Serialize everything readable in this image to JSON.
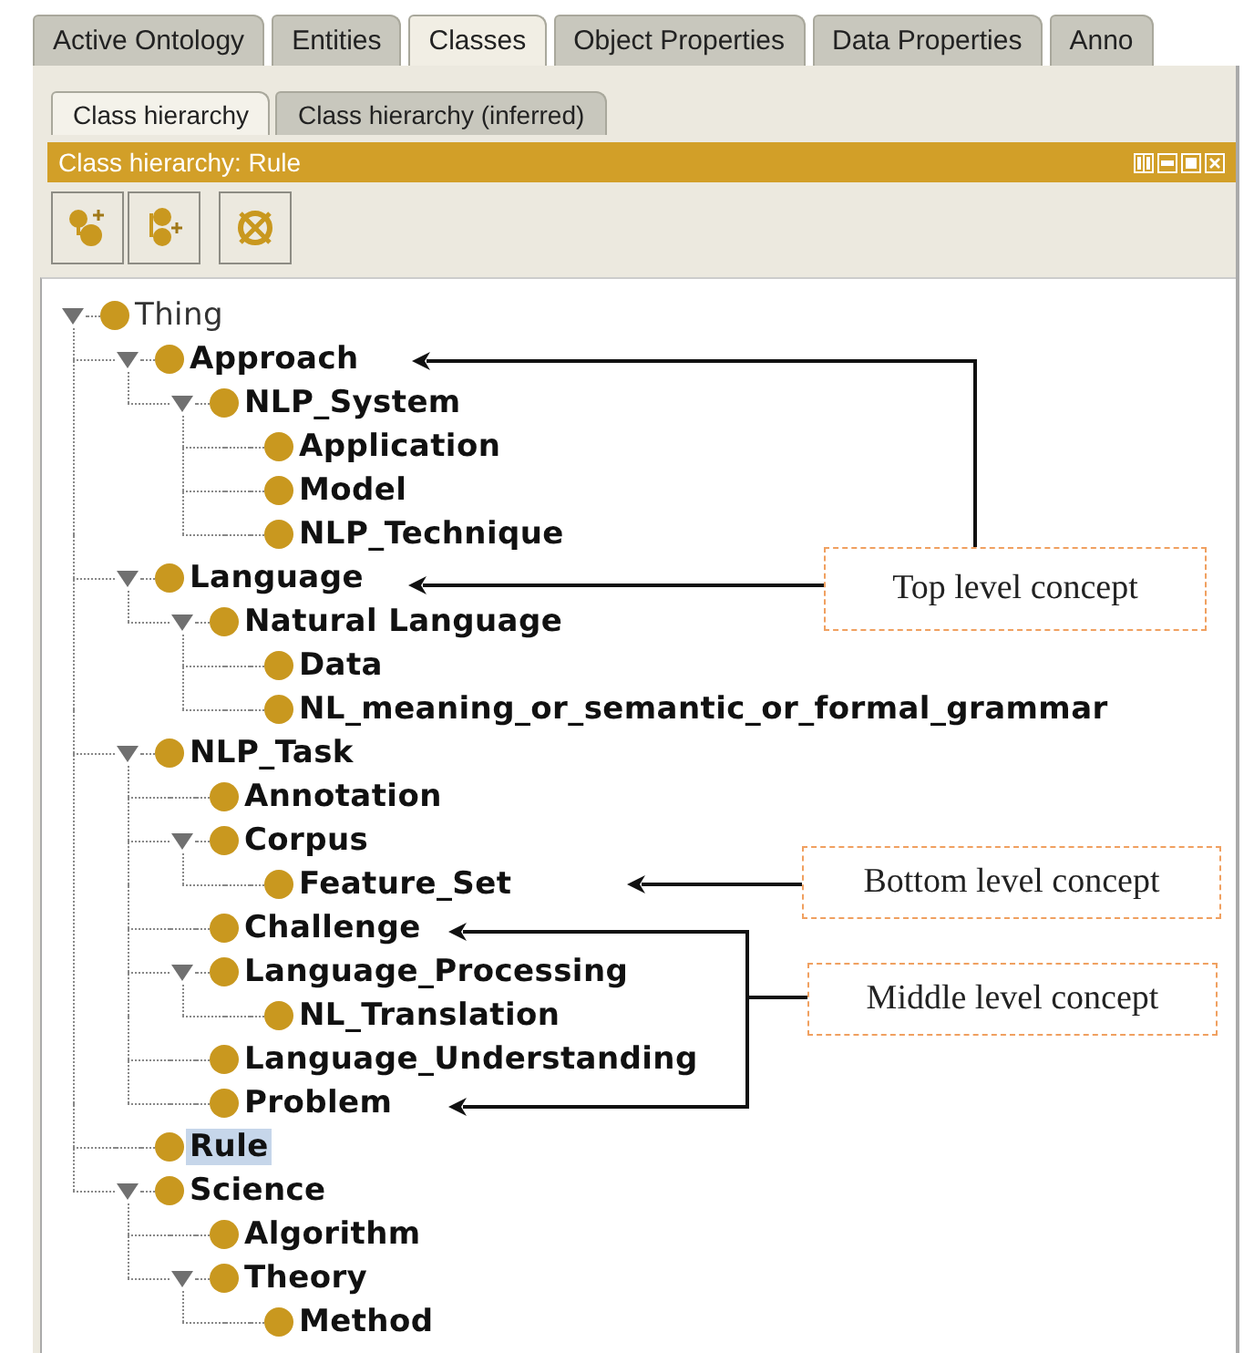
{
  "tabs": [
    {
      "label": "Active Ontology",
      "selected": false
    },
    {
      "label": "Entities",
      "selected": false
    },
    {
      "label": "Classes",
      "selected": true
    },
    {
      "label": "Object Properties",
      "selected": false
    },
    {
      "label": "Data Properties",
      "selected": false
    },
    {
      "label": "Anno",
      "selected": false
    }
  ],
  "subtabs": [
    {
      "label": "Class hierarchy",
      "selected": true
    },
    {
      "label": "Class hierarchy (inferred)",
      "selected": false
    }
  ],
  "panel": {
    "title": "Class hierarchy: Rule"
  },
  "tree": [
    {
      "label": "Thing",
      "kind": "root",
      "selected": false,
      "expanded": true,
      "children": [
        {
          "label": "Approach",
          "selected": false,
          "expanded": true,
          "children": [
            {
              "label": "NLP_System",
              "selected": false,
              "expanded": true,
              "children": [
                {
                  "label": "Application",
                  "selected": false
                },
                {
                  "label": "Model",
                  "selected": false
                },
                {
                  "label": "NLP_Technique",
                  "selected": false
                }
              ]
            }
          ]
        },
        {
          "label": "Language",
          "selected": false,
          "expanded": true,
          "children": [
            {
              "label": "Natural  Language",
              "selected": false,
              "expanded": true,
              "children": [
                {
                  "label": "Data",
                  "selected": false
                },
                {
                  "label": "NL_meaning_or_semantic_or_formal_grammar",
                  "selected": false
                }
              ]
            }
          ]
        },
        {
          "label": "NLP_Task",
          "selected": false,
          "expanded": true,
          "children": [
            {
              "label": "Annotation",
              "selected": false
            },
            {
              "label": "Corpus",
              "selected": false,
              "expanded": true,
              "children": [
                {
                  "label": "Feature_Set",
                  "selected": false
                }
              ]
            },
            {
              "label": "Challenge",
              "selected": false
            },
            {
              "label": "Language_Processing",
              "selected": false,
              "expanded": true,
              "children": [
                {
                  "label": "NL_Translation",
                  "selected": false
                }
              ]
            },
            {
              "label": "Language_Understanding",
              "selected": false
            },
            {
              "label": "Problem",
              "selected": false
            }
          ]
        },
        {
          "label": "Rule",
          "selected": true
        },
        {
          "label": "Science",
          "selected": false,
          "expanded": true,
          "children": [
            {
              "label": "Algorithm",
              "selected": false
            },
            {
              "label": "Theory",
              "selected": false,
              "expanded": true,
              "children": [
                {
                  "label": "Method",
                  "selected": false
                }
              ]
            }
          ]
        }
      ]
    }
  ],
  "annotations": [
    {
      "label": "Top level concept"
    },
    {
      "label": "Bottom level concept"
    },
    {
      "label": "Middle level concept"
    }
  ]
}
